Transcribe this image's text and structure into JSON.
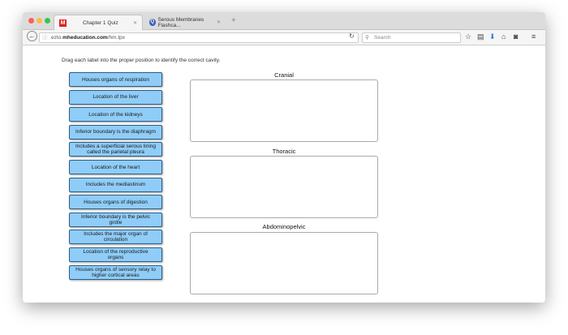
{
  "browser": {
    "tabs": [
      {
        "label": "Chapter 1 Quiz",
        "icon": "M"
      },
      {
        "label": "Serous Membranes Flashca...",
        "icon": "Q"
      }
    ],
    "new_tab": "+",
    "url_domain": "ezto.",
    "url_host": "mheducation.com",
    "url_path": "/hm.tpx",
    "search_placeholder": "Search"
  },
  "quiz": {
    "instruction": "Drag each label into the proper position to identify the correct cavity.",
    "labels": [
      "Houses organs of respiration",
      "Location of the liver",
      "Location of the kidneys",
      "Inferior boundary is the diaphragm",
      "Includes a superficial serous lining called the parietal pleura",
      "Location of the heart",
      "Includes the mediastinum",
      "Houses organs of digestion",
      "Inferior boundary is the pelvic girdle",
      "Includes the major organ of circulation",
      "Location of the reproductive organs",
      "Houses organs of sensory relay to higher cortical areas"
    ],
    "zones": [
      "Cranial",
      "Thoracic",
      "Abdominopelvic"
    ]
  },
  "colors": {
    "label_bg": "#8fcdf8",
    "label_border": "#2c5d86"
  }
}
